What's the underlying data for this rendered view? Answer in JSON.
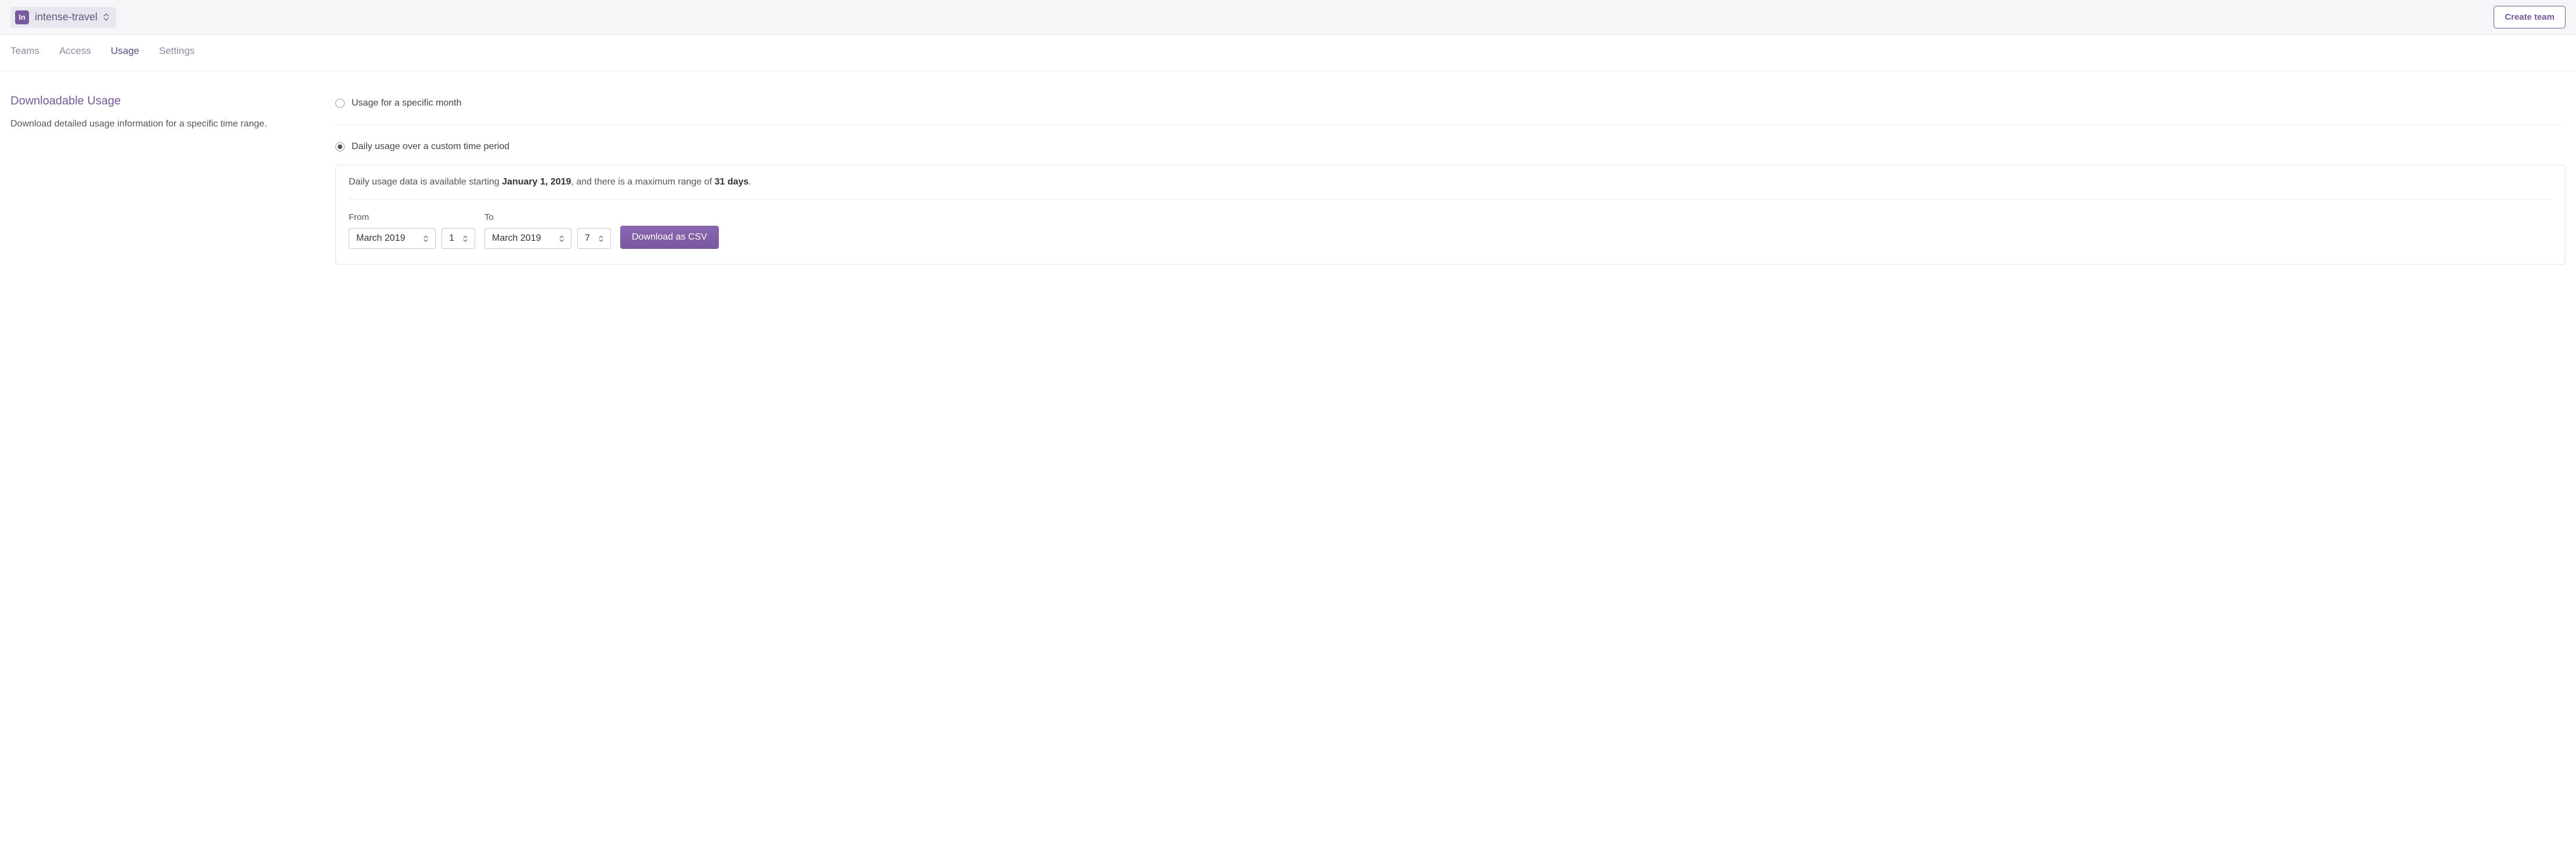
{
  "header": {
    "project_badge": "In",
    "project_name": "intense-travel",
    "create_team_label": "Create team"
  },
  "tabs": [
    {
      "label": "Teams",
      "active": false
    },
    {
      "label": "Access",
      "active": false
    },
    {
      "label": "Usage",
      "active": true
    },
    {
      "label": "Settings",
      "active": false
    }
  ],
  "sidebar": {
    "title": "Downloadable Usage",
    "description": "Download detailed usage information for a specific time range."
  },
  "options": {
    "monthly_label": "Usage for a specific month",
    "daily_label": "Daily usage over a custom time period"
  },
  "panel": {
    "help_prefix": "Daily usage data is available starting ",
    "help_date": "January 1, 2019",
    "help_mid": ", and there is a maximum range of ",
    "help_days": "31 days",
    "help_suffix": ".",
    "from_label": "From",
    "to_label": "To",
    "from_month": "March 2019",
    "from_day": "1",
    "to_month": "March 2019",
    "to_day": "7",
    "download_label": "Download as CSV"
  }
}
